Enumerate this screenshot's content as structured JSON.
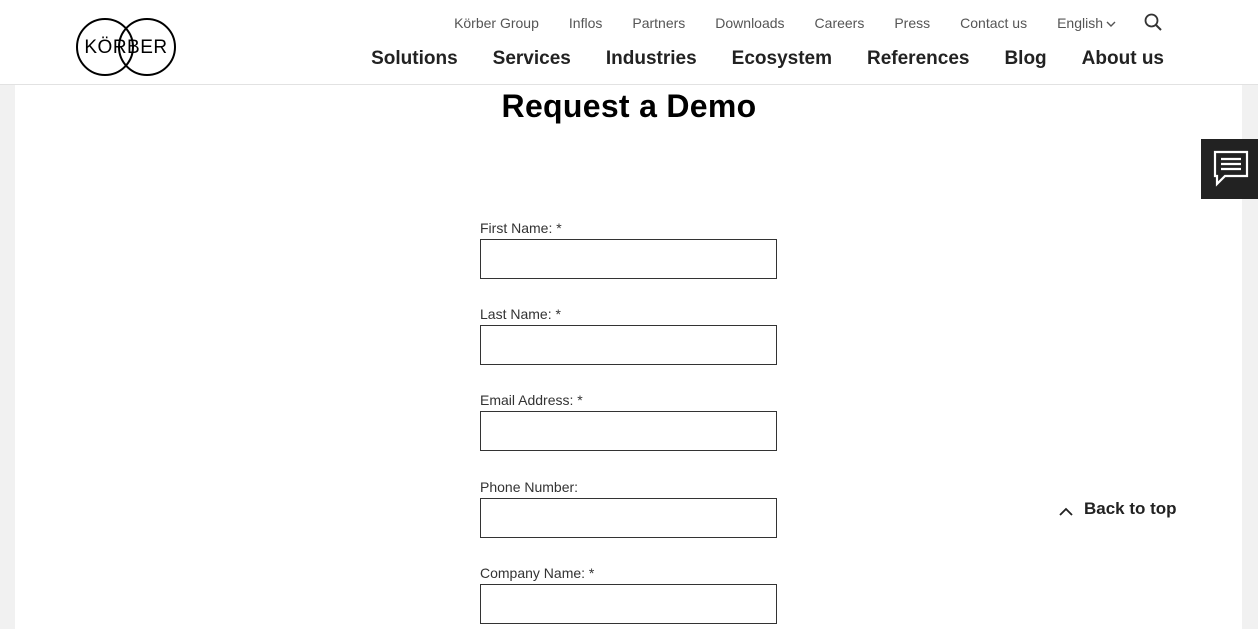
{
  "brand": {
    "logo_text": "KÖRBER"
  },
  "topnav": {
    "items": [
      "Körber Group",
      "Inflos",
      "Partners",
      "Downloads",
      "Careers",
      "Press",
      "Contact us"
    ],
    "language": "English"
  },
  "mainnav": {
    "items": [
      "Solutions",
      "Services",
      "Industries",
      "Ecosystem",
      "References",
      "Blog",
      "About us"
    ]
  },
  "page": {
    "title": "Request a Demo"
  },
  "form": {
    "first_name_label": "First Name: *",
    "last_name_label": "Last Name: *",
    "email_label": "Email Address: *",
    "phone_label": "Phone Number:",
    "company_label": "Company Name: *"
  },
  "back_to_top": "Back to top",
  "icons": {
    "search": "search-icon",
    "chevron": "chevron-down-icon",
    "chat": "chat-icon",
    "arrow_up": "chevron-up-icon"
  }
}
